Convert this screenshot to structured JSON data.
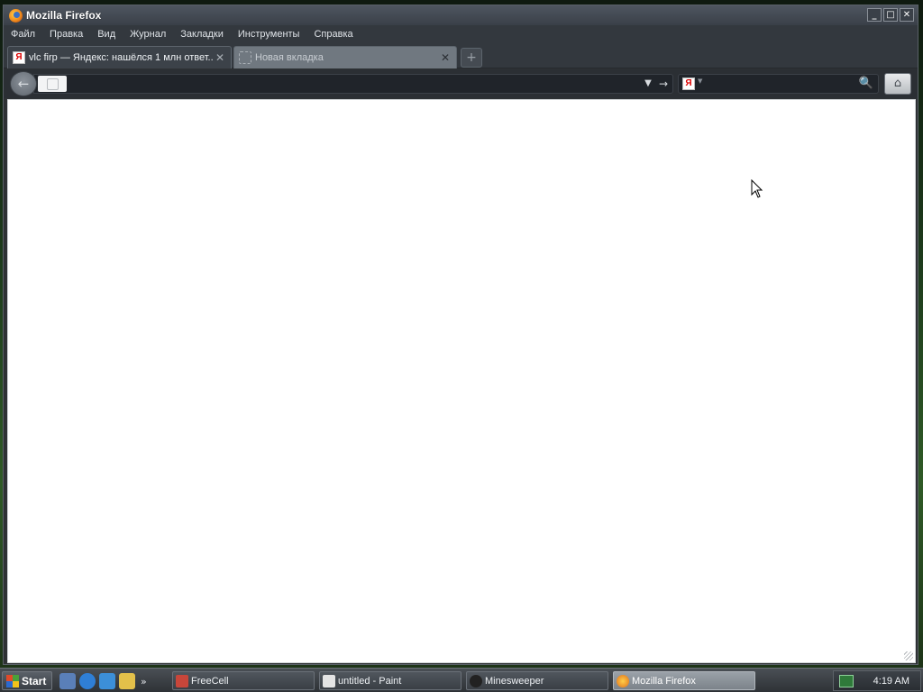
{
  "window": {
    "title": "Mozilla Firefox",
    "controls": {
      "minimize": "_",
      "maximize": "□",
      "close": "✕"
    }
  },
  "menubar": {
    "items": [
      "Файл",
      "Правка",
      "Вид",
      "Журнал",
      "Закладки",
      "Инструменты",
      "Справка"
    ]
  },
  "tabs": [
    {
      "label": "vlc firp — Яндекс: нашёлся 1 млн ответ...",
      "favicon": "yandex-icon",
      "active": false
    },
    {
      "label": "Новая вкладка",
      "favicon": "blank-page-icon",
      "active": true
    }
  ],
  "navbar": {
    "url_value": "",
    "search_value": "",
    "search_engine": "Я"
  },
  "icons": {
    "back": "←",
    "dropdown": "▼",
    "go": "→",
    "search": "🔍",
    "home": "⌂",
    "new_tab": "+",
    "tab_close": "✕",
    "quicklaunch_more": "»"
  },
  "taskbar": {
    "start_label": "Start",
    "tasks": [
      {
        "label": "FreeCell",
        "icon": "freecell-icon",
        "active": false
      },
      {
        "label": "untitled - Paint",
        "icon": "paint-icon",
        "active": false
      },
      {
        "label": "Minesweeper",
        "icon": "minesweeper-icon",
        "active": false
      },
      {
        "label": "Mozilla Firefox",
        "icon": "firefox-icon",
        "active": true
      }
    ],
    "clock": "4:19 AM"
  },
  "colors": {
    "window_bg": "#2e3134",
    "content_bg": "#ffffff",
    "active_task": "#8a9198"
  }
}
